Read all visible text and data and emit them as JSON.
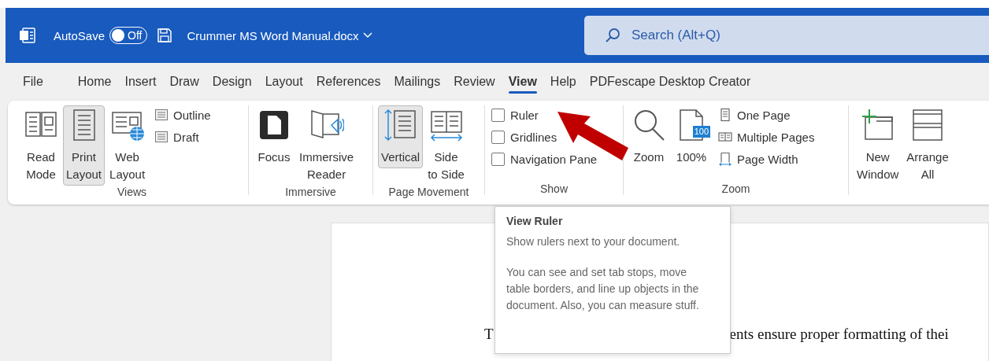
{
  "title_bar": {
    "autosave_label": "AutoSave",
    "autosave_toggle": {
      "label": "Off",
      "on": false
    },
    "filename": "Crummer MS Word Manual.docx"
  },
  "search": {
    "placeholder": "Search (Alt+Q)"
  },
  "tabs": [
    {
      "label": "File",
      "selected": false
    },
    {
      "label": "Home",
      "selected": false
    },
    {
      "label": "Insert",
      "selected": false
    },
    {
      "label": "Draw",
      "selected": false
    },
    {
      "label": "Design",
      "selected": false
    },
    {
      "label": "Layout",
      "selected": false
    },
    {
      "label": "References",
      "selected": false
    },
    {
      "label": "Mailings",
      "selected": false
    },
    {
      "label": "Review",
      "selected": false
    },
    {
      "label": "View",
      "selected": true
    },
    {
      "label": "Help",
      "selected": false
    },
    {
      "label": "PDFescape Desktop Creator",
      "selected": false
    }
  ],
  "ribbon": {
    "groups": [
      {
        "label": "Views",
        "items": [
          {
            "kind": "large",
            "lines": [
              "Read",
              "Mode"
            ],
            "selected": false
          },
          {
            "kind": "large",
            "lines": [
              "Print",
              "Layout"
            ],
            "selected": true
          },
          {
            "kind": "large",
            "lines": [
              "Web",
              "Layout"
            ],
            "selected": false
          },
          {
            "kind": "small",
            "label": "Outline"
          },
          {
            "kind": "small",
            "label": "Draft"
          }
        ]
      },
      {
        "label": "Immersive",
        "items": [
          {
            "kind": "large",
            "lines": [
              "Focus"
            ],
            "selected": false
          },
          {
            "kind": "large",
            "lines": [
              "Immersive",
              "Reader"
            ],
            "selected": false
          }
        ]
      },
      {
        "label": "Page Movement",
        "items": [
          {
            "kind": "large",
            "lines": [
              "Vertical"
            ],
            "selected": true
          },
          {
            "kind": "large",
            "lines": [
              "Side",
              "to Side"
            ],
            "selected": false
          }
        ]
      },
      {
        "label": "Show",
        "items": [
          {
            "kind": "check",
            "label": "Ruler",
            "checked": false
          },
          {
            "kind": "check",
            "label": "Gridlines",
            "checked": false
          },
          {
            "kind": "check",
            "label": "Navigation Pane",
            "checked": false
          }
        ]
      },
      {
        "label": "Zoom",
        "items": [
          {
            "kind": "large",
            "lines": [
              "Zoom"
            ],
            "selected": false
          },
          {
            "kind": "large",
            "lines": [
              "100%"
            ],
            "badge": "100",
            "selected": false
          },
          {
            "kind": "small",
            "label": "One Page"
          },
          {
            "kind": "small",
            "label": "Multiple Pages"
          },
          {
            "kind": "small",
            "label": "Page Width"
          }
        ]
      },
      {
        "items": [
          {
            "kind": "large",
            "lines": [
              "New",
              "Window"
            ],
            "selected": false
          },
          {
            "kind": "large",
            "lines": [
              "Arrange",
              "All"
            ],
            "selected": false
          }
        ]
      }
    ]
  },
  "tooltip": {
    "title": "View Ruler",
    "paragraphs": [
      "Show rulers next to your document.",
      "You can see and set tab stops, move table borders, and line up objects in the document. Also, you can measure stuff."
    ]
  },
  "document": {
    "text_fragments": [
      "T",
      "ents ensure proper formatting of thei"
    ]
  }
}
